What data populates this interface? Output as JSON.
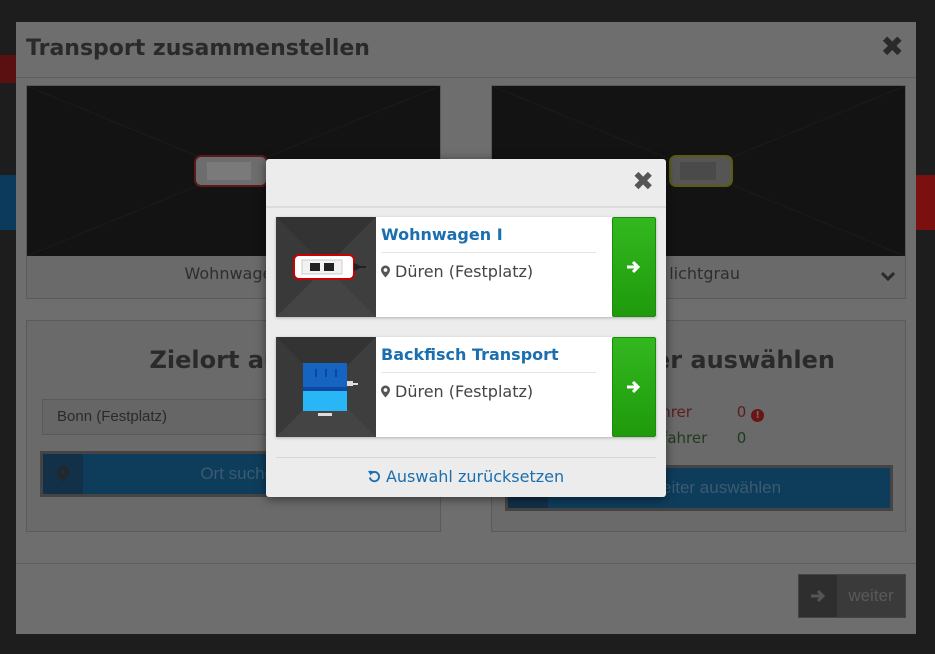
{
  "dialog": {
    "title": "Transport zusammenstellen",
    "close_symbol": "✖"
  },
  "vehicles": {
    "left_label": "Wohnwagen",
    "right_label": "lichtgrau"
  },
  "destination": {
    "heading": "Zielort ausw",
    "select_value": "Bonn (Festplatz)",
    "search_button": "Ort suchen a"
  },
  "staff": {
    "heading": "iter auswählen",
    "driver_label": "ahrer",
    "driver_count": "0",
    "codriver_label": "itfahrer",
    "codriver_count": "0",
    "select_button": "rbeiter auswählen"
  },
  "footer": {
    "next_label": "weiter"
  },
  "modal": {
    "close_symbol": "✖",
    "items": [
      {
        "title": "Wohnwagen I",
        "location": "Düren (Festplatz)"
      },
      {
        "title": "Backfisch Transport",
        "location": "Düren (Festplatz)"
      }
    ],
    "reset_label": "Auswahl zurücksetzen"
  },
  "colors": {
    "accent_blue": "#1a6fb0",
    "select_green": "#2aab18",
    "overlay": "#6e6e6e"
  }
}
